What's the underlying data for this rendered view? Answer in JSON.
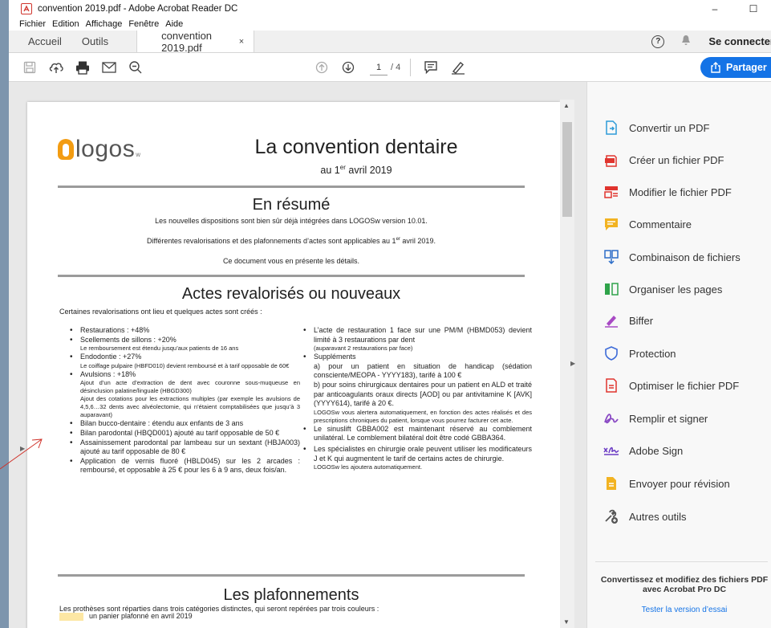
{
  "window": {
    "title": "convention 2019.pdf - Adobe Acrobat Reader DC",
    "minimize": "–",
    "maximize": "☐"
  },
  "menu": [
    "Fichier",
    "Edition",
    "Affichage",
    "Fenêtre",
    "Aide"
  ],
  "tabs": {
    "home": "Accueil",
    "tools": "Outils",
    "document": "convention 2019.pdf",
    "close": "×",
    "signin": "Se connecter"
  },
  "toolbar": {
    "page_current": "1",
    "page_total": "/ 4",
    "share_label": "Partager"
  },
  "document": {
    "logo_text": "logos",
    "logo_sub": "w",
    "title": "La convention dentaire",
    "date_prefix": "au 1",
    "date_sup": "er",
    "date_suffix": " avril 2019",
    "summary_title": "En résumé",
    "summary_line1": "Les nouvelles dispositions sont bien sûr déjà intégrées dans LOGOSw version 10.01.",
    "summary_line2_prefix": "Différentes revalorisations et des plafonnements d’actes sont applicables au 1",
    "summary_line2_sup": "er",
    "summary_line2_suffix": " avril 2019.",
    "summary_line3": "Ce document vous en présente les détails.",
    "acts_title": "Actes revalorisés ou nouveaux",
    "acts_intro": "Certaines revalorisations ont lieu et quelques actes sont créés :",
    "left_col": {
      "l1": "Restaurations : +48%",
      "l2": "Scellements de sillons : +20%",
      "l2_sub": "Le remboursement est étendu jusqu’aux patients de 16 ans",
      "l3": "Endodontie : +27%",
      "l3_sub": "Le coiffage pulpaire (HBFD010) devient remboursé et à tarif opposable de 60€",
      "l4": "Avulsions : +18%",
      "l4_sub1": "Ajout d’un acte d’extraction de dent avec couronne sous-muqueuse en désinclusion palatine/linguale (HBGD300)",
      "l4_sub2": "Ajout des cotations pour les extractions multiples (par exemple les avulsions de 4,5,6…32 dents avec alvéolectomie, qui n’étaient comptabilisées que jusqu’à 3 auparavant)",
      "l5": "Bilan bucco-dentaire : étendu aux enfants de 3 ans",
      "l6": "Bilan parodontal (HBQD001) ajouté au tarif opposable de 50 €",
      "l7": "Assainissement parodontal par lambeau sur un sextant (HBJA003) ajouté au tarif opposable de 80 €",
      "l8": "Application de vernis fluoré (HBLD045) sur les 2 arcades : remboursé, et opposable à 25 € pour les 6 à 9 ans, deux fois/an."
    },
    "right_col": {
      "r1": "L’acte de restauration 1 face sur une PM/M (HBMD053) devient limité à 3 restaurations par dent",
      "r1_sub": "(auparavant 2 restaurations par face)",
      "r2": "Suppléments",
      "r2_a": "a) pour un patient en situation de handicap (sédation consciente/MEOPA - YYYY183), tarifé à 100 €",
      "r2_b": "b) pour soins chirurgicaux dentaires pour un patient en ALD et traité par anticoagulants oraux directs [AOD] ou par antivitamine K [AVK] (YYYY614), tarifé à 20 €.",
      "r2_note": "LOGOSw vous alertera automatiquement, en fonction des actes réalisés et des prescriptions chroniques du patient, lorsque vous pourrez facturer cet acte.",
      "r3": "Le sinuslift GBBA002 est maintenant réservé au comblement unilatéral. Le comblement bilatéral doit être codé GBBA364.",
      "r4": "Les spécialistes en chirurgie orale peuvent utiliser les modificateurs J et K qui augmentent le tarif de certains actes de chirurgie.",
      "r4_note": "LOGOSw les ajoutera automatiquement."
    },
    "caps_title": "Les plafonnements",
    "caps_intro": "Les prothèses sont réparties dans trois catégories distinctes, qui seront repérées par trois couleurs :",
    "caps_yellow": "un panier plafonné en avril 2019"
  },
  "tools_pane": {
    "items": [
      {
        "label": "Convertir un PDF",
        "color": "#2d9bd8"
      },
      {
        "label": "Créer un fichier PDF",
        "color": "#e0342e"
      },
      {
        "label": "Modifier le fichier PDF",
        "color": "#e0342e"
      },
      {
        "label": "Commentaire",
        "color": "#f2b322"
      },
      {
        "label": "Combinaison de fichiers",
        "color": "#2d6ec8"
      },
      {
        "label": "Organiser les pages",
        "color": "#2fa34a"
      },
      {
        "label": "Biffer",
        "color": "#a84ac4"
      },
      {
        "label": "Protection",
        "color": "#3d6bd8"
      },
      {
        "label": "Optimiser le fichier PDF",
        "color": "#e0342e"
      },
      {
        "label": "Remplir et signer",
        "color": "#8a4ac4"
      },
      {
        "label": "Adobe Sign",
        "color": "#6a3ac4"
      },
      {
        "label": "Envoyer pour révision",
        "color": "#f2b322"
      },
      {
        "label": "Autres outils",
        "color": "#555555"
      }
    ],
    "promo": "Convertissez et modifiez des fichiers PDF avec Acrobat Pro DC",
    "trial": "Tester la version d’essai"
  }
}
